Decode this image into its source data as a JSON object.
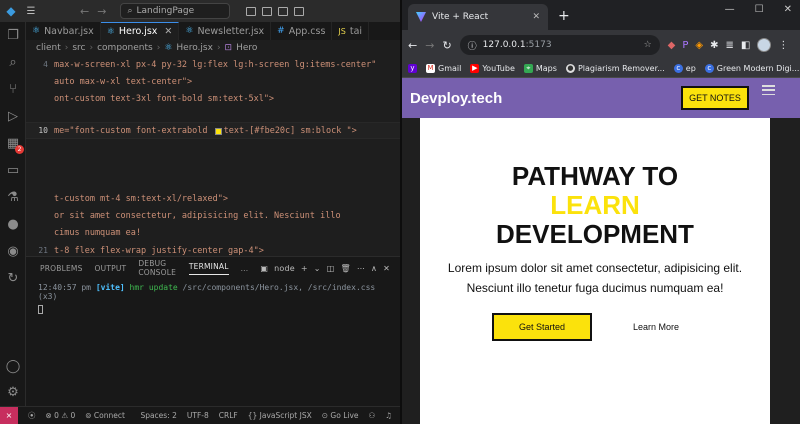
{
  "vscode": {
    "command_center": "LandingPage",
    "tabs": [
      {
        "icon": "JSX",
        "label": "Navbar.jsx"
      },
      {
        "icon": "JSX",
        "label": "Hero.jsx"
      },
      {
        "icon": "JSX",
        "label": "Newsletter.jsx"
      },
      {
        "icon": "#",
        "label": "App.css"
      },
      {
        "icon": "JS",
        "label": "tai"
      }
    ],
    "breadcrumbs": [
      "client",
      "src",
      "components",
      "Hero.jsx",
      "Hero"
    ],
    "code_lines": [
      {
        "num": "4",
        "text": "max-w-screen-xl px-4 py-32 lg:flex lg:h-screen lg:items-center\""
      },
      {
        "num": "",
        "text": "auto max-w-xl text-center\">"
      },
      {
        "num": "",
        "text": "ont-custom text-3xl font-bold sm:text-5xl\">"
      },
      {
        "num": "10",
        "text_before": "me=\"font-custom font-extrabold ",
        "text_after": "text-[#fbe20c] sm:block \">"
      },
      {
        "num": "",
        "text": ""
      },
      {
        "num": "",
        "text": ""
      },
      {
        "num": "",
        "text": ""
      },
      {
        "num": "",
        "text": "t-custom mt-4 sm:text-xl/relaxed\">"
      },
      {
        "num": "",
        "text": "or sit amet consectetur, adipisicing elit. Nesciunt illo"
      },
      {
        "num": "",
        "text": "cimus numquam ea!"
      },
      {
        "num": "",
        "text": ""
      },
      {
        "num": "21",
        "text": "t-8 flex flex-wrap justify-center gap-4\">"
      }
    ],
    "panel_tabs": [
      "PROBLEMS",
      "OUTPUT",
      "DEBUG CONSOLE",
      "TERMINAL",
      "..."
    ],
    "panel_tools": {
      "shell": "node",
      "plus": "+"
    },
    "terminal": {
      "time": "12:40:57 pm",
      "tag": "[vite]",
      "msg": "hmr update",
      "paths": "/src/components/Hero.jsx, /src/index.css (x3)"
    },
    "status": {
      "errors": "0",
      "warnings": "0",
      "connect": "Connect",
      "spaces": "Spaces: 2",
      "encoding": "UTF-8",
      "eol": "CRLF",
      "language": "JavaScript JSX",
      "golive": "Go Live"
    },
    "swatch_color": "#fbe20c",
    "accent_color": "#c72e5e"
  },
  "chrome": {
    "tab_title": "Vite + React",
    "url_host": "127.0.0.1",
    "url_port": ":5173",
    "bookmarks": [
      {
        "label": "Gmail"
      },
      {
        "label": "YouTube"
      },
      {
        "label": "Maps"
      },
      {
        "label": "Plagiarism Remover..."
      },
      {
        "label": "ep"
      },
      {
        "label": "Green Modern Digi..."
      }
    ]
  },
  "site": {
    "logo": "Devploy.tech",
    "header_button": "GET NOTES",
    "hero_line1": "PATHWAY TO",
    "hero_accent": "LEARN",
    "hero_line3": "DEVELOPMENT",
    "description": "Lorem ipsum dolor sit amet consectetur, adipisicing elit. Nesciunt illo tenetur fuga ducimus numquam ea!",
    "primary_cta": "Get Started",
    "secondary_cta": "Learn More",
    "colors": {
      "header": "#7760ae",
      "accent": "#fbe20c"
    }
  }
}
